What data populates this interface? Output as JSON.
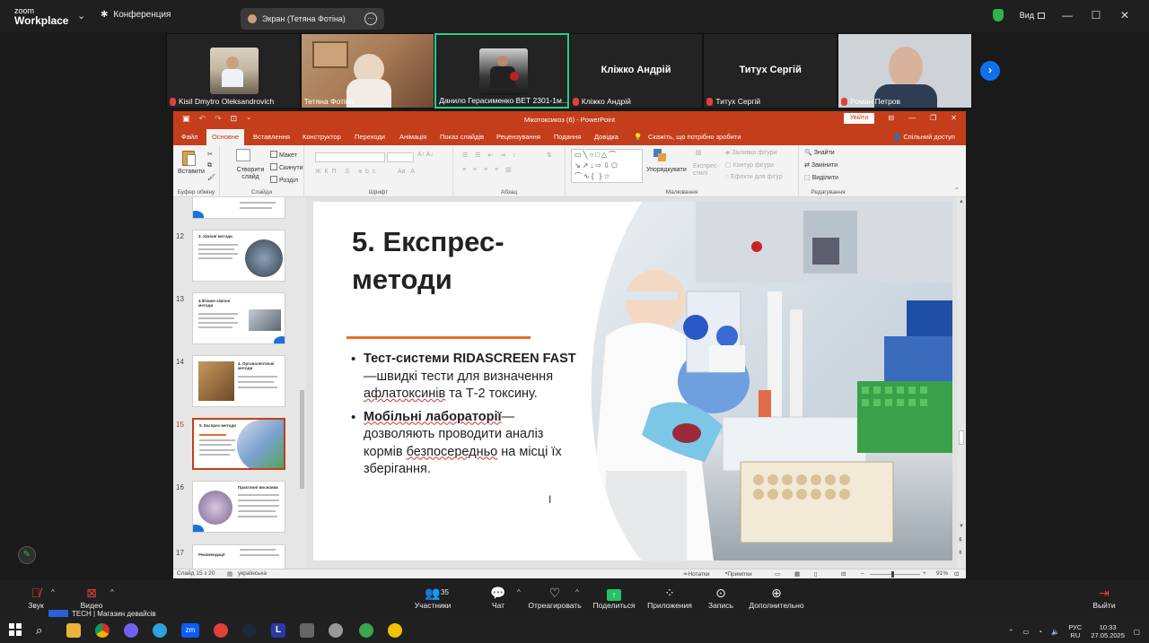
{
  "zoom": {
    "logo_line1": "zoom",
    "logo_line2": "Workplace",
    "conference_label": "Конференция",
    "screen_share_label": "Экран (Тетяна Фотіна)",
    "view_label": "Вид",
    "participants": [
      {
        "name": "Kisil Dmytro Oleksandrovich",
        "muted": true,
        "has_video": true
      },
      {
        "name": "Тетяна Фотіна",
        "muted": false,
        "has_video": true
      },
      {
        "name": "Данило Герасименко ВЕТ 2301-1м...",
        "muted": false,
        "has_video": true,
        "active": true
      },
      {
        "name": "Кліжко Андрій",
        "display_name": "Кліжко Андрій",
        "muted": true,
        "has_video": false
      },
      {
        "name": "Титух Сергій",
        "display_name": "Титух Сергій",
        "muted": true,
        "has_video": false
      },
      {
        "name": "Роман Петров",
        "muted": true,
        "has_video": true
      }
    ],
    "toolbar": {
      "audio": "Звук",
      "video": "Видео",
      "participants": "Участники",
      "participants_count": "35",
      "chat": "Чат",
      "reactions": "Отреагировать",
      "share": "Поделиться",
      "apps": "Приложения",
      "record": "Запись",
      "more": "Дополнительно",
      "leave": "Выйти"
    },
    "notification": "TECH | Магазин девайсів"
  },
  "ppt": {
    "title": "Мікотоксикоз (6)  -  PowerPoint",
    "sign_in": "Увійти",
    "tabs": [
      "Файл",
      "Основне",
      "Вставлення",
      "Конструктор",
      "Переходи",
      "Анімація",
      "Показ слайдів",
      "Рецензування",
      "Подання",
      "Довідка"
    ],
    "tell_me": "Скажіть, що потрібно зробити",
    "share": "Спільний доступ",
    "ribbon": {
      "paste": "Вставити",
      "clipboard": "Буфер обміну",
      "new_slide": "Створити слайд",
      "layout": "Макет",
      "reset": "Скинути",
      "section": "Розділ",
      "slides": "Слайди",
      "font": "Шрифт",
      "paragraph": "Абзац",
      "arrange": "Упорядкувати",
      "quick_styles": "Експрес-стилі",
      "shape_fill": "Заливка фігури",
      "shape_outline": "Контур фігури",
      "shape_effects": "Ефекти для фігур",
      "drawing": "Малювання",
      "find": "Знайти",
      "replace": "Замінити",
      "select": "Виділити",
      "editing": "Редагування"
    },
    "thumbnails": [
      {
        "num": "12",
        "title": "3. Хімічні методи"
      },
      {
        "num": "13",
        "title": "4.Фізико-хімічні методи"
      },
      {
        "num": "14",
        "title": "4. Органолептичні методи"
      },
      {
        "num": "15",
        "title": "5. Експрес-методи",
        "current": true
      },
      {
        "num": "16",
        "title": "Практичні висновки"
      },
      {
        "num": "17",
        "title": "Рекомендації"
      }
    ],
    "slide": {
      "title": "5. Експрес-методи",
      "b1_bold": "Тест-системи RIDASCREEN FAST",
      "b1_rest": "—швидкі тести для визначення ",
      "b1_sq": "афлатоксинів",
      "b1_end": " та Т-2 токсину.",
      "b2_bold": "Мобільні лабораторії",
      "b2_rest": "—дозволяють проводити аналіз кормів ",
      "b2_sq": "безпосередньо",
      "b2_end": " на місці їх зберігання."
    },
    "status": {
      "slide_of": "Слайд 15 з 20",
      "language": "українська",
      "notes": "Нотатки",
      "comments": "Примітки",
      "zoom": "91%"
    }
  },
  "taskbar": {
    "lang_top": "РУС",
    "lang_bottom": "RU",
    "time": "10:33",
    "date": "27.05.2025"
  }
}
